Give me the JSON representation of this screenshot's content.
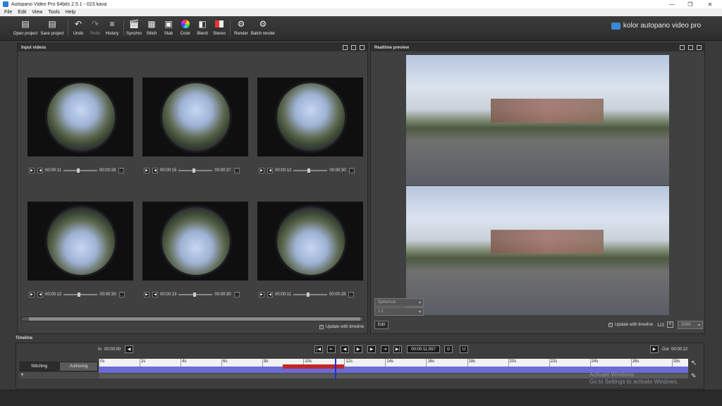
{
  "window": {
    "title": "Autopano Video Pro 64bits 2.5.1 - 023.kava"
  },
  "menu": {
    "items": [
      "File",
      "Edit",
      "View",
      "Tools",
      "Help"
    ]
  },
  "toolbar": {
    "buttons": [
      {
        "label": "Open project",
        "icon": "open-project-icon",
        "enabled": true
      },
      {
        "label": "Save project",
        "icon": "save-project-icon",
        "enabled": true
      },
      {
        "label": "Undo",
        "icon": "undo-icon",
        "enabled": true
      },
      {
        "label": "Redo",
        "icon": "redo-icon",
        "enabled": false
      },
      {
        "label": "History",
        "icon": "history-icon",
        "enabled": true
      },
      {
        "label": "Synchro",
        "icon": "clapper-icon",
        "enabled": true
      },
      {
        "label": "Stitch",
        "icon": "stitch-icon",
        "enabled": true
      },
      {
        "label": "Stab",
        "icon": "stab-icon",
        "enabled": true
      },
      {
        "label": "Color",
        "icon": "color-wheel-icon",
        "enabled": true
      },
      {
        "label": "Blend",
        "icon": "blend-icon",
        "enabled": true
      },
      {
        "label": "Stereo",
        "icon": "stereo-icon",
        "enabled": true
      },
      {
        "label": "Render",
        "icon": "gear-icon",
        "enabled": true
      },
      {
        "label": "Batch render",
        "icon": "batch-gear-icon",
        "enabled": true
      }
    ],
    "brand": "kolor autopano video pro"
  },
  "input_panel": {
    "title": "Input videos",
    "videos": [
      {
        "current": "00:00:11",
        "total": "00:00:28",
        "progress": 0.4
      },
      {
        "current": "00:00:15",
        "total": "00:00:37",
        "progress": 0.4
      },
      {
        "current": "00:00:12",
        "total": "00:00:30",
        "progress": 0.4
      },
      {
        "current": "00:00:12",
        "total": "00:00:30",
        "progress": 0.4
      },
      {
        "current": "00:00:13",
        "total": "00:00:30",
        "progress": 0.43
      },
      {
        "current": "00:00:11",
        "total": "00:00:28",
        "progress": 0.4
      }
    ],
    "update_label": "Update with timeline"
  },
  "preview_panel": {
    "title": "Realtime preview",
    "projection": "Spherical",
    "mode": "1:1",
    "edit_label": "Edit",
    "update_label": "Update with timeline",
    "count": "123",
    "resolution": "2048"
  },
  "timeline": {
    "title": "Timeline",
    "in_label": "In",
    "in_time": "00:00:00",
    "out_label": "Out",
    "out_time": "00:00:12",
    "current_time": "00:00:11,557",
    "tabs": [
      "Stitching",
      "Authoring"
    ],
    "ticks": [
      "0s",
      "2s",
      "4s",
      "6s",
      "8s",
      "10s",
      "12s",
      "14s",
      "16s",
      "18s",
      "20s",
      "22s",
      "24s",
      "26s",
      "28s"
    ],
    "selection": [
      9,
      12
    ],
    "playhead": 11.557,
    "duration": 28.8
  },
  "watermark": {
    "line1": "Activate Windows",
    "line2": "Go to Settings to activate Windows."
  }
}
